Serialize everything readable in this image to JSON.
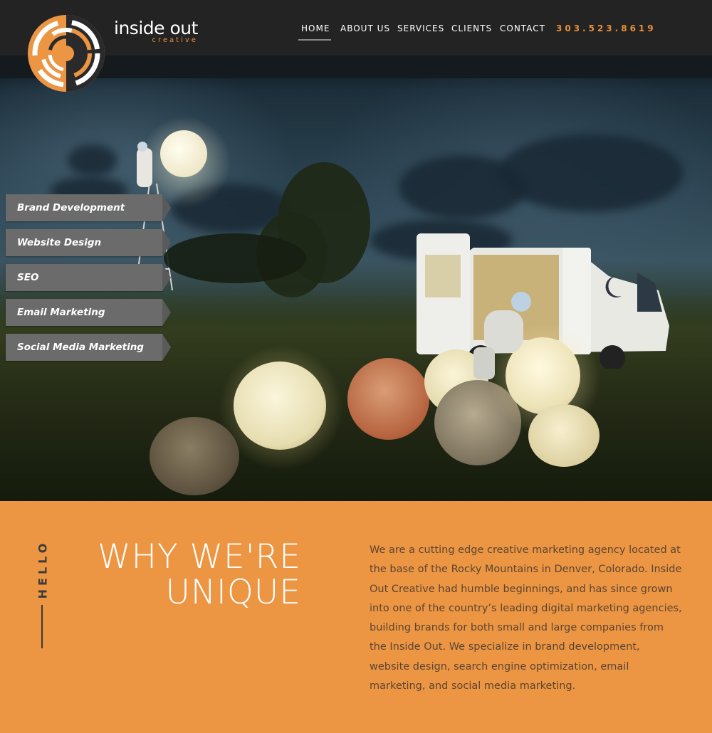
{
  "brand": {
    "name": "inside out",
    "sub": "creative"
  },
  "nav": [
    {
      "label": "HOME",
      "active": true
    },
    {
      "label": "ABOUT US"
    },
    {
      "label": "SERVICES"
    },
    {
      "label": "CLIENTS"
    },
    {
      "label": "CONTACT"
    }
  ],
  "phone": "303.523.8619",
  "services": [
    "Brand Development",
    "Website Design",
    "SEO",
    "Email Marketing",
    "Social Media Marketing"
  ],
  "why": {
    "eyebrow": "HELLO",
    "title_line1": "WHY WE'RE",
    "title_line2": "UNIQUE",
    "body": "We are a cutting edge creative marketing agency located at the base of the Rocky Mountains in Denver, Colorado. Inside Out Creative had humble beginnings, and has since grown into one of the country’s leading digital marketing agencies, building brands for both small and large companies from the Inside Out. We specialize in brand development, website design, search engine optimization, email marketing, and social media marketing."
  },
  "colors": {
    "accent": "#ec9543",
    "header_bg": "#232323",
    "tab_bg": "#6b6b6b"
  },
  "icons": {
    "logo": "concentric-circles-logo-icon"
  }
}
